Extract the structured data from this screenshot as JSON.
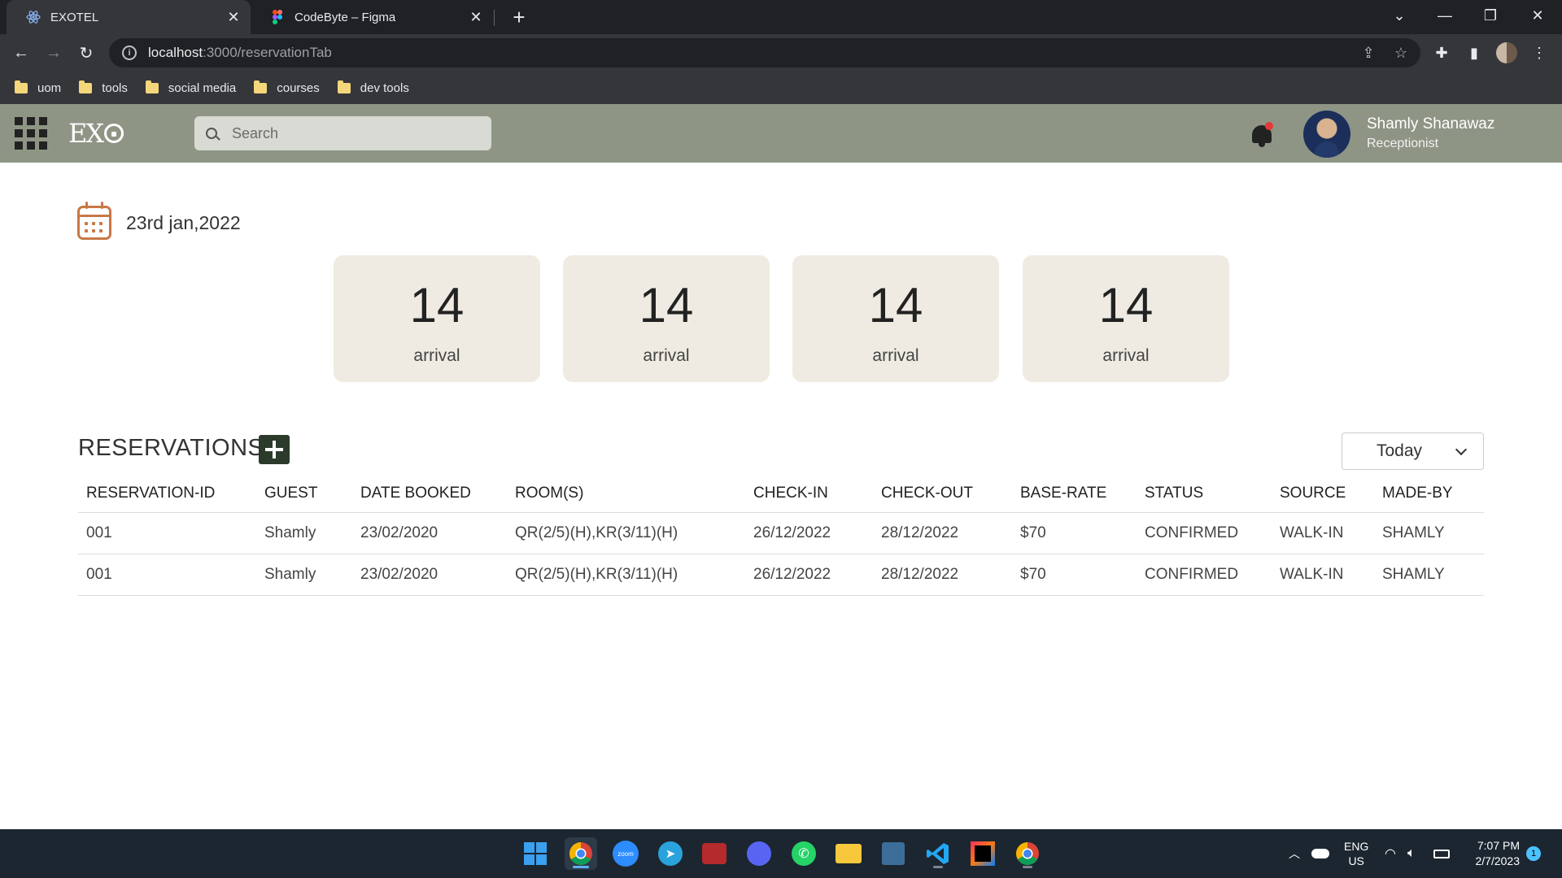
{
  "browser": {
    "tabs": [
      {
        "title": "EXOTEL",
        "active": true,
        "icon": "react-icon"
      },
      {
        "title": "CodeByte – Figma",
        "active": false,
        "icon": "figma-icon"
      }
    ],
    "url": {
      "host": "localhost",
      "path": ":3000/reservationTab"
    },
    "bookmarks": [
      "uom",
      "tools",
      "social media",
      "courses",
      "dev tools"
    ]
  },
  "header": {
    "logo": "EX",
    "search_placeholder": "Search",
    "user": {
      "name": "Shamly Shanawaz",
      "role": "Receptionist"
    }
  },
  "main": {
    "date": "23rd jan,2022",
    "stats": [
      {
        "value": "14",
        "label": "arrival"
      },
      {
        "value": "14",
        "label": "arrival"
      },
      {
        "value": "14",
        "label": "arrival"
      },
      {
        "value": "14",
        "label": "arrival"
      }
    ],
    "reservations_title": "RESERVATIONS",
    "filter_value": "Today",
    "table": {
      "columns": [
        "RESERVATION-ID",
        "GUEST",
        "DATE BOOKED",
        "ROOM(S)",
        "CHECK-IN",
        "CHECK-OUT",
        "BASE-RATE",
        "STATUS",
        "SOURCE",
        "MADE-BY"
      ],
      "rows": [
        [
          "001",
          "Shamly",
          "23/02/2020",
          "QR(2/5)(H),KR(3/11)(H)",
          "26/12/2022",
          "28/12/2022",
          "$70",
          "CONFIRMED",
          "WALK-IN",
          "SHAMLY"
        ],
        [
          "001",
          "Shamly",
          "23/02/2020",
          "QR(2/5)(H),KR(3/11)(H)",
          "26/12/2022",
          "28/12/2022",
          "$70",
          "CONFIRMED",
          "WALK-IN",
          "SHAMLY"
        ]
      ]
    }
  },
  "taskbar": {
    "apps": [
      "windows-start-icon",
      "chrome-icon",
      "zoom-icon",
      "telegram-icon",
      "game-icon",
      "discord-icon",
      "whatsapp-icon",
      "file-explorer-icon",
      "mysql-icon",
      "vscode-icon",
      "intellij-icon",
      "chrome-icon"
    ],
    "lang": "ENG",
    "region": "US",
    "time": "7:07 PM",
    "date": "2/7/2023",
    "notification_count": "1"
  },
  "colors": {
    "header_bg": "#8e9585",
    "card_bg": "#efebe3",
    "accent": "#c87845",
    "add_button": "#2b3a2b"
  }
}
